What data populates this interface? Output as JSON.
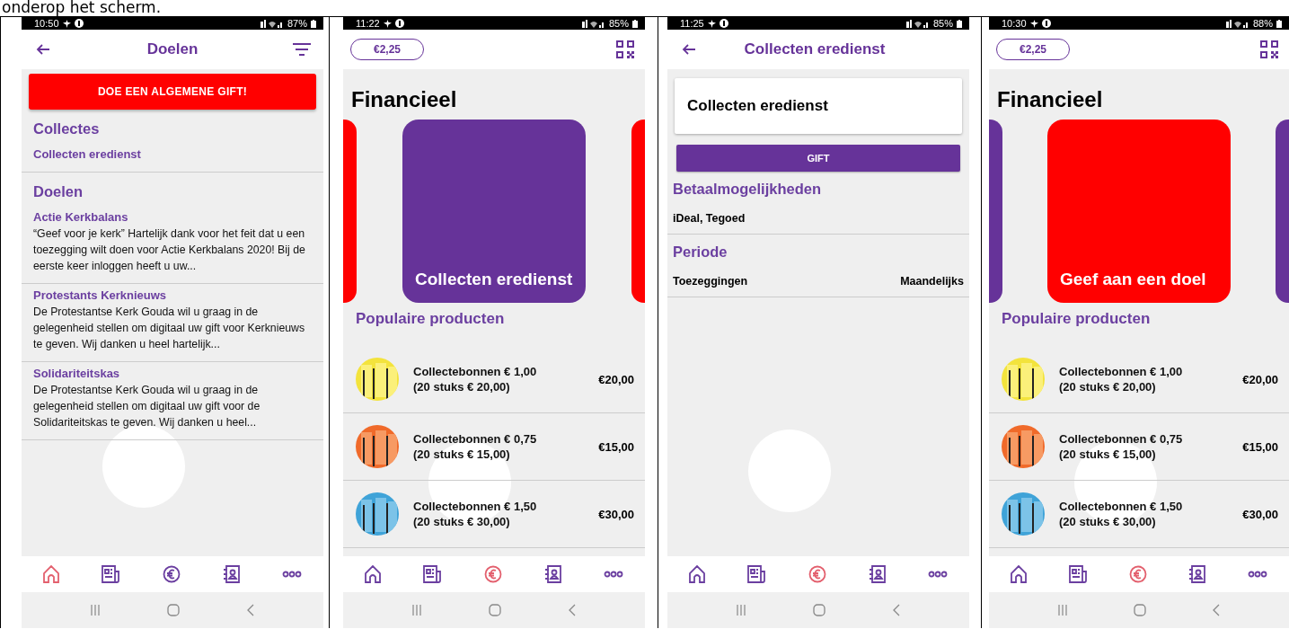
{
  "caption": "onderop het scherm.",
  "phones": [
    {
      "status": {
        "time": "10:50",
        "battery": "87%"
      },
      "nav": [
        {
          "selected": true
        },
        {
          "selected": false
        },
        {
          "selected": false
        },
        {
          "selected": false
        },
        {
          "selected": false
        }
      ],
      "screen": {
        "kind": "goals",
        "title": "Doelen",
        "gift_button": "DOE EEN ALGEMENE GIFT!",
        "sections": [
          {
            "heading": "Collectes",
            "items": [
              {
                "title": "Collecten eredienst"
              }
            ]
          },
          {
            "heading": "Doelen",
            "items": [
              {
                "title": "Actie Kerkbalans",
                "description": "“Geef voor je kerk” Hartelijk dank voor het feit dat u een toezegging wilt doen voor Actie Kerkbalans 2020! Bij de eerste keer inloggen heeft u uw..."
              },
              {
                "title": "Protestants Kerknieuws",
                "description": "De Protestantse Kerk Gouda wil u graag in de gelegenheid stellen om digitaal uw gift voor Kerknieuws te geven.  Wij danken u heel hartelijk..."
              },
              {
                "title": "Solidariteitskas",
                "description": "De Protestantse Kerk Gouda wil u graag in de gelegenheid stellen om digitaal uw gift voor de Solidariteitskas te geven.  Wij danken u heel..."
              }
            ]
          }
        ]
      }
    },
    {
      "status": {
        "time": "11:22",
        "battery": "85%"
      },
      "nav": [
        {
          "selected": false
        },
        {
          "selected": false
        },
        {
          "selected": true
        },
        {
          "selected": false
        },
        {
          "selected": false
        }
      ],
      "screen": {
        "kind": "financial",
        "balance": "€2,25",
        "title": "Financieel",
        "carousel": [
          {
            "kind": "previous",
            "color": "#ff0000"
          },
          {
            "kind": "current",
            "label": "Collecten eredienst",
            "color": "#663399"
          },
          {
            "kind": "next",
            "color": "#ff0000"
          }
        ],
        "products_heading": "Populaire producten",
        "products": [
          {
            "kind": "picture",
            "name": "Collectebonnen € 1,00",
            "detail": "(20 stuks € 20,00)",
            "price": "€20,00"
          },
          {
            "kind": "picture",
            "name": "Collectebonnen € 0,75",
            "detail": "(20 stuks € 15,00)",
            "price": "€15,00"
          },
          {
            "kind": "picture",
            "name": "Collectebonnen € 1,50",
            "detail": "(20 stuks € 30,00)",
            "price": "€30,00"
          }
        ]
      }
    },
    {
      "status": {
        "time": "11:25",
        "battery": "85%"
      },
      "nav": [
        {
          "selected": false
        },
        {
          "selected": false
        },
        {
          "selected": true
        },
        {
          "selected": false
        },
        {
          "selected": false
        }
      ],
      "screen": {
        "kind": "detail",
        "title": "Collecten eredienst",
        "card_title": "Collecten eredienst",
        "gift_button": "GIFT",
        "sections": [
          {
            "heading": "Betaalmogelijkheden",
            "rows": [
              {
                "label": "iDeal, Tegoed"
              }
            ]
          },
          {
            "heading": "Periode",
            "rows": [
              {
                "label": "Toezeggingen",
                "value": "Maandelijks"
              }
            ]
          }
        ]
      }
    },
    {
      "status": {
        "time": "10:30",
        "battery": "88%"
      },
      "nav": [
        {
          "selected": false
        },
        {
          "selected": false
        },
        {
          "selected": true
        },
        {
          "selected": false
        },
        {
          "selected": false
        }
      ],
      "screen": {
        "kind": "financial",
        "balance": "€2,25",
        "title": "Financieel",
        "carousel": [
          {
            "kind": "previous",
            "color": "#663399"
          },
          {
            "kind": "current",
            "label": "Geef aan een doel",
            "color": "#ff0000"
          },
          {
            "kind": "next",
            "color": "#663399"
          }
        ],
        "products_heading": "Populaire producten",
        "products": [
          {
            "kind": "picture",
            "name": "Collectebonnen € 1,00",
            "detail": "(20 stuks € 20,00)",
            "price": "€20,00"
          },
          {
            "kind": "picture",
            "name": "Collectebonnen € 0,75",
            "detail": "(20 stuks € 15,00)",
            "price": "€15,00"
          },
          {
            "kind": "picture",
            "name": "Collectebonnen € 1,50",
            "detail": "(20 stuks € 30,00)",
            "price": "€30,00"
          }
        ]
      }
    }
  ]
}
